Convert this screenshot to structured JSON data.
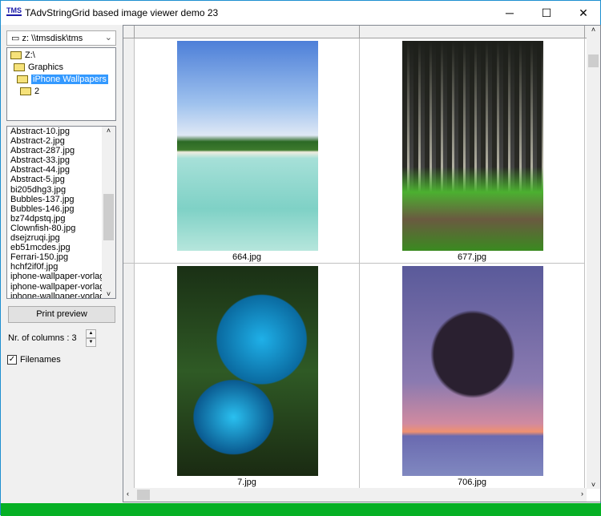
{
  "window": {
    "title": "TAdvStringGrid based image viewer demo 23",
    "icon_text": "TMS",
    "minimize": "─",
    "maximize": "☐",
    "close": "✕"
  },
  "drive": {
    "value": "z: \\\\tmsdisk\\tms"
  },
  "tree": [
    {
      "label": "Z:\\"
    },
    {
      "label": "Graphics"
    },
    {
      "label": "iPhone Wallpapers",
      "selected": true
    },
    {
      "label": "2"
    }
  ],
  "files": [
    "Abstract-10.jpg",
    "Abstract-2.jpg",
    "Abstract-287.jpg",
    "Abstract-33.jpg",
    "Abstract-44.jpg",
    "Abstract-5.jpg",
    "bi205dhg3.jpg",
    "Bubbles-137.jpg",
    "Bubbles-146.jpg",
    "bz74dpstq.jpg",
    "Clownfish-80.jpg",
    "dsejzruqi.jpg",
    "eb51mcdes.jpg",
    "Ferrari-150.jpg",
    "hchf2if0f.jpg",
    "iphone-wallpaper-vorlage",
    "iphone-wallpaper-vorlage",
    "iphone-wallpaper-vorlage"
  ],
  "controls": {
    "print_preview": "Print preview",
    "columns_label": "Nr. of columns : 3",
    "filenames_label": "Filenames",
    "filenames_checked": true
  },
  "grid": {
    "images": [
      {
        "caption": "664.jpg"
      },
      {
        "caption": "677.jpg"
      },
      {
        "caption": "7.jpg"
      },
      {
        "caption": "706.jpg"
      }
    ]
  },
  "colors": {
    "selection": "#3399ff",
    "status": "#06b025"
  }
}
